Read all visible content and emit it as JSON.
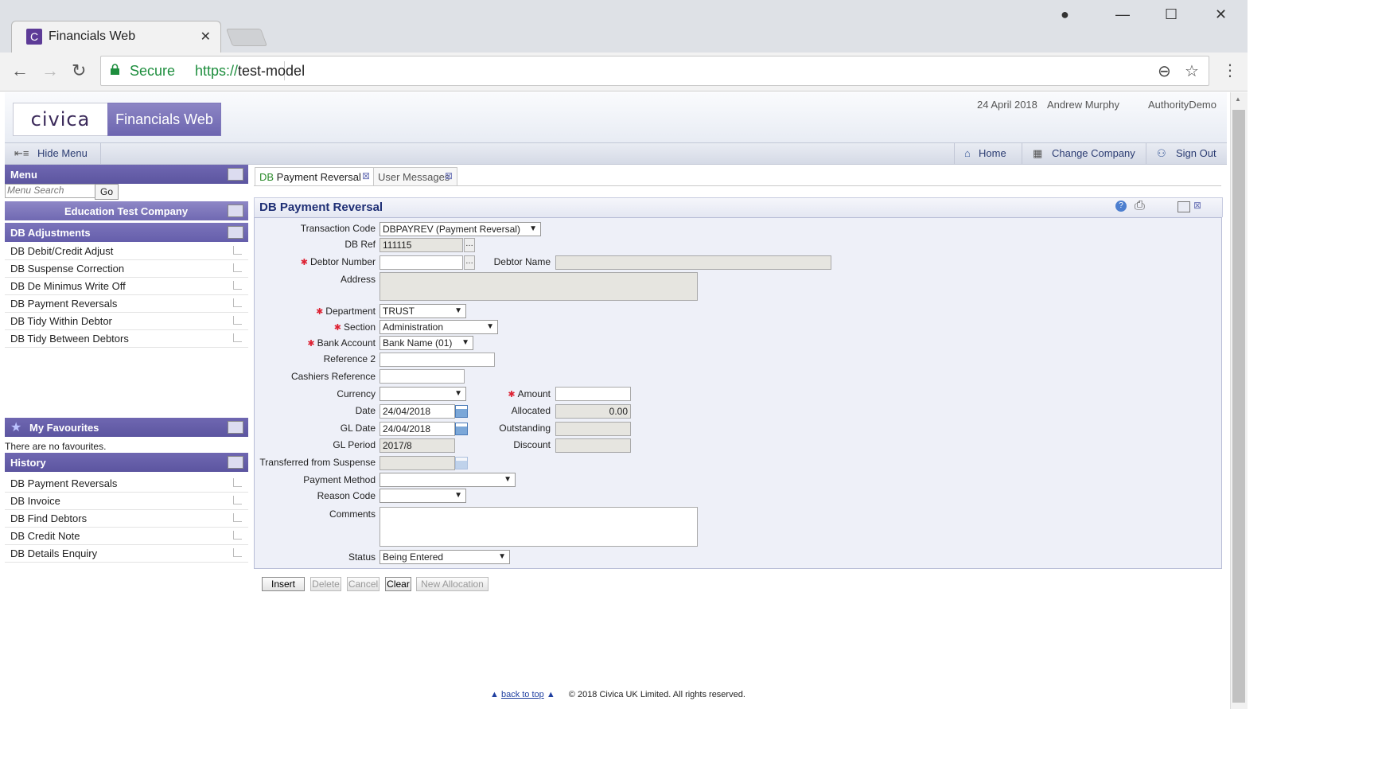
{
  "browser": {
    "tab_title": "Financials Web",
    "secure_label": "Secure",
    "url_scheme": "https://",
    "url_host": "test-model"
  },
  "header": {
    "logo_text": "civica",
    "brand": "Financials Web",
    "date": "24 April 2018",
    "user": "Andrew Murphy",
    "authority": "AuthorityDemo"
  },
  "menubar": {
    "hide_menu": "Hide Menu",
    "home": "Home",
    "change_company": "Change Company",
    "sign_out": "Sign Out"
  },
  "sidebar": {
    "menu_title": "Menu",
    "search_placeholder": "Menu Search",
    "go": "Go",
    "company": "Education Test Company",
    "section_title": "DB Adjustments",
    "items": [
      {
        "label": "DB Debit/Credit Adjust"
      },
      {
        "label": "DB Suspense Correction"
      },
      {
        "label": "DB De Minimus Write Off"
      },
      {
        "label": "DB Payment Reversals"
      },
      {
        "label": "DB Tidy Within Debtor"
      },
      {
        "label": "DB Tidy Between Debtors"
      }
    ],
    "favourites_title": "My Favourites",
    "favourites_empty": "There are no favourites.",
    "history_title": "History",
    "history": [
      {
        "label": "DB Payment Reversals"
      },
      {
        "label": "DB Invoice"
      },
      {
        "label": "DB Find Debtors"
      },
      {
        "label": "DB Credit Note"
      },
      {
        "label": "DB Details Enquiry"
      }
    ]
  },
  "tabs": [
    {
      "prefix": "DB",
      "label": " Payment Reversal"
    },
    {
      "label": "User Messages"
    }
  ],
  "form": {
    "title": "DB Payment Reversal",
    "labels": {
      "transaction_code": "Transaction Code",
      "db_ref": "DB Ref",
      "debtor_number": "Debtor Number",
      "debtor_name": "Debtor Name",
      "address": "Address",
      "department": "Department",
      "section": "Section",
      "bank_account": "Bank Account",
      "reference2": "Reference 2",
      "cashiers_reference": "Cashiers Reference",
      "currency": "Currency",
      "amount": "Amount",
      "date": "Date",
      "allocated": "Allocated",
      "gl_date": "GL Date",
      "outstanding": "Outstanding",
      "gl_period": "GL Period",
      "discount": "Discount",
      "transferred": "Transferred from Suspense",
      "payment_method": "Payment Method",
      "reason_code": "Reason Code",
      "comments": "Comments",
      "status": "Status"
    },
    "values": {
      "transaction_code": "DBPAYREV (Payment Reversal)",
      "db_ref": "111115",
      "department": "TRUST",
      "section": "Administration",
      "bank_account": "Bank Name (01)",
      "date": "24/04/2018",
      "allocated": "0.00",
      "gl_date": "24/04/2018",
      "gl_period": "2017/8",
      "status": "Being Entered"
    },
    "buttons": {
      "insert": "Insert",
      "delete": "Delete",
      "cancel": "Cancel",
      "clear": "Clear",
      "new_allocation": "New Allocation"
    }
  },
  "footer": {
    "back_to_top": "back to top",
    "copyright": "© 2018 Civica UK Limited. All rights reserved."
  }
}
